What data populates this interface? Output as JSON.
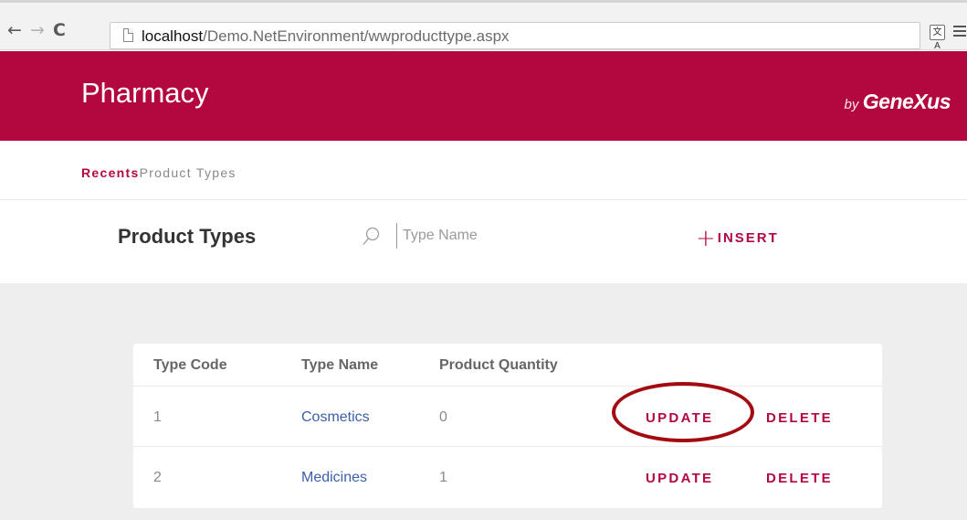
{
  "browser": {
    "back_icon": "←",
    "forward_icon": "→",
    "reload_icon": "C",
    "url_host": "localhost",
    "url_path": "/Demo.NetEnvironment/wwproducttype.aspx",
    "translate_icon": "文A"
  },
  "header": {
    "title": "Pharmacy",
    "brand_by": "by",
    "brand_name": "GeneXus"
  },
  "breadcrumb": {
    "recents": "Recents",
    "current": "Product Types"
  },
  "toolbar": {
    "page_title": "Product Types",
    "search_placeholder": "Type Name",
    "insert_icon": "+",
    "insert_label": "INSERT"
  },
  "table": {
    "columns": [
      "Type Code",
      "Type Name",
      "Product Quantity"
    ],
    "rows": [
      {
        "code": "1",
        "name": "Cosmetics",
        "quantity": "0",
        "update": "UPDATE",
        "delete": "DELETE"
      },
      {
        "code": "2",
        "name": "Medicines",
        "quantity": "1",
        "update": "UPDATE",
        "delete": "DELETE"
      }
    ]
  },
  "colors": {
    "brand": "#b3073f",
    "annotation": "#a30b11",
    "link": "#3b5fa8"
  }
}
